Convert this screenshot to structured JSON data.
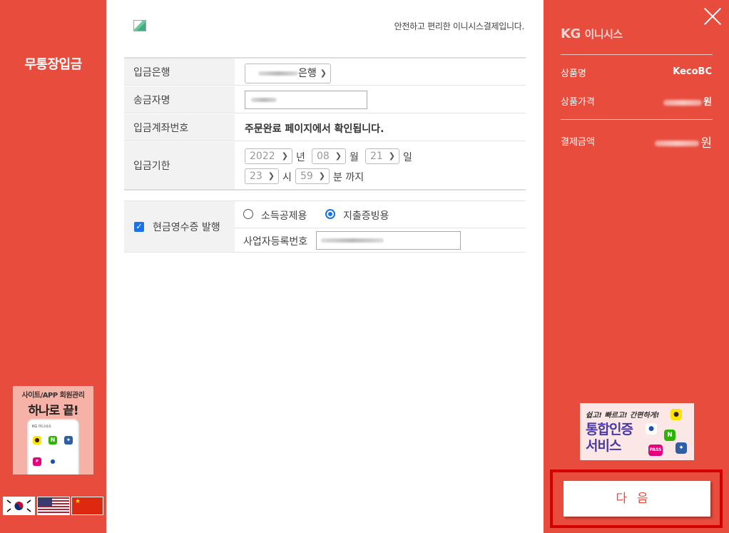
{
  "left": {
    "title": "무통장입금",
    "promo": {
      "line1": "사이트/APP 회원관리",
      "line2": "하나로 끝!",
      "phone_brand": "KG 이니시스",
      "n_icon": "N"
    },
    "flags": [
      "korean-flag-icon",
      "us-flag-icon",
      "china-flag-icon"
    ]
  },
  "center": {
    "tagline": "안전하고 편리한 이니시스결제입니다.",
    "deposit_bank": {
      "label": "입금은행",
      "value_suffix": "은행"
    },
    "sender_name": {
      "label": "송금자명"
    },
    "account_number": {
      "label": "입금계좌번호",
      "value": "주문완료 페이지에서 확인됩니다."
    },
    "deadline": {
      "label": "입금기한",
      "year": "2022",
      "year_unit": "년",
      "month": "08",
      "month_unit": "월",
      "day": "21",
      "day_unit": "일",
      "hour": "23",
      "hour_unit": "시",
      "minute": "59",
      "minute_unit": "분 까지"
    },
    "receipt": {
      "label": "현금영수증 발행",
      "checked": true,
      "option_income": "소득공제용",
      "option_expense": "지출증빙용",
      "selected": "지출증빙용",
      "biz_number_label": "사업자등록번호"
    }
  },
  "right": {
    "logo_kg": "KG",
    "logo_text": "이니시스",
    "product_name_label": "상품명",
    "product_name_value": "KecoBC",
    "product_price_label": "상품가격",
    "product_price_unit": "원",
    "total_label": "결제금액",
    "total_unit": "원",
    "promo": {
      "line1": "쉽고! 빠르고! 간편하게!",
      "line2a": "통합인증",
      "line2b": "서비스",
      "n_icon": "N",
      "pass_text": "PASS"
    },
    "next_button": "다음"
  },
  "colors": {
    "accent": "#e84c3d",
    "highlight_border": "#d40000",
    "check_blue": "#1a73e8"
  }
}
